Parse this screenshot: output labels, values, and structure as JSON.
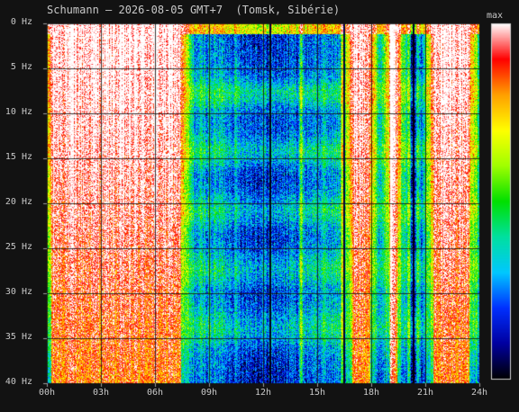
{
  "chart_data": {
    "type": "heatmap",
    "title": "Schumann — 2026-08-05 GMT+7  (Tomsk, Sibérie)",
    "xlabel": "",
    "ylabel": "",
    "x_ticks": [
      "00h",
      "03h",
      "06h",
      "09h",
      "12h",
      "15h",
      "18h",
      "21h",
      "24h"
    ],
    "y_ticks": [
      "0 Hz",
      "5 Hz",
      "10 Hz",
      "15 Hz",
      "20 Hz",
      "25 Hz",
      "30 Hz",
      "35 Hz",
      "40 Hz"
    ],
    "x_range_hours": [
      0,
      24
    ],
    "y_range_hz": [
      0,
      40
    ],
    "grid": true,
    "colorbar": {
      "max_label": "max",
      "colormap": [
        "#000000",
        "#0000a0",
        "#0030ff",
        "#00c8ff",
        "#00e0a0",
        "#00e000",
        "#a0ff00",
        "#ffff00",
        "#ffa000",
        "#ff0000",
        "#ffffff"
      ]
    },
    "schumann_bands_hz": [
      7.8,
      14.3,
      20.8,
      27.3,
      33.8
    ],
    "saturated_intervals_hours": [
      [
        0.0,
        7.7
      ],
      [
        16.7,
        18.2
      ],
      [
        18.8,
        19.7
      ],
      [
        21.2,
        23.7
      ]
    ],
    "bright_streaks_hours": [
      14.1,
      16.4,
      19.1,
      20.1,
      20.6
    ],
    "dark_gaps_hours": [
      12.4,
      16.5,
      20.35
    ]
  }
}
